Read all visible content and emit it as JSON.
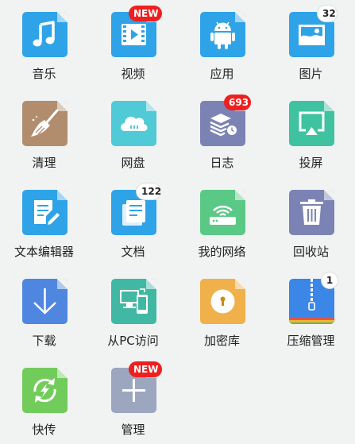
{
  "colors": {
    "background": "#f0f3f2",
    "badge_red": "#f01f1f",
    "music": "#2fa3e8",
    "video": "#2fa3e8",
    "apps": "#2fa3e8",
    "pictures": "#2fa3e8",
    "cleanup": "#b18d6e",
    "cloud": "#4fcad6",
    "logs": "#7b83b4",
    "cast": "#3ec29f",
    "text_editor": "#2fa3e8",
    "documents": "#2fa3e8",
    "my_network": "#5bc986",
    "recycle": "#7b83b4",
    "download": "#4f86df",
    "pc_access": "#41b8a3",
    "vault": "#f0b04a",
    "compress": "#3b86e6",
    "quick_share": "#72cc5b",
    "manage": "#9ca7bf"
  },
  "items": [
    {
      "label": "音乐",
      "icon": "music-note-icon"
    },
    {
      "label": "视频",
      "icon": "video-play-icon",
      "badge": "NEW"
    },
    {
      "label": "应用",
      "icon": "android-icon"
    },
    {
      "label": "图片",
      "icon": "picture-icon",
      "badge": "32"
    },
    {
      "label": "清理",
      "icon": "broom-icon"
    },
    {
      "label": "网盘",
      "icon": "cloud-drive-icon"
    },
    {
      "label": "日志",
      "icon": "log-stack-icon",
      "badge": "693"
    },
    {
      "label": "投屏",
      "icon": "screen-cast-icon"
    },
    {
      "label": "文本编辑器",
      "icon": "text-edit-icon"
    },
    {
      "label": "文档",
      "icon": "document-icon",
      "badge": "122"
    },
    {
      "label": "我的网络",
      "icon": "router-wifi-icon"
    },
    {
      "label": "回收站",
      "icon": "trash-icon"
    },
    {
      "label": "下载",
      "icon": "download-arrow-icon"
    },
    {
      "label": "从PC访问",
      "icon": "pc-phone-icon"
    },
    {
      "label": "加密库",
      "icon": "lock-vault-icon"
    },
    {
      "label": "压缩管理",
      "icon": "zip-archive-icon",
      "badge": "1"
    },
    {
      "label": "快传",
      "icon": "quick-transfer-icon"
    },
    {
      "label": "管理",
      "icon": "plus-icon",
      "badge": "NEW"
    }
  ]
}
